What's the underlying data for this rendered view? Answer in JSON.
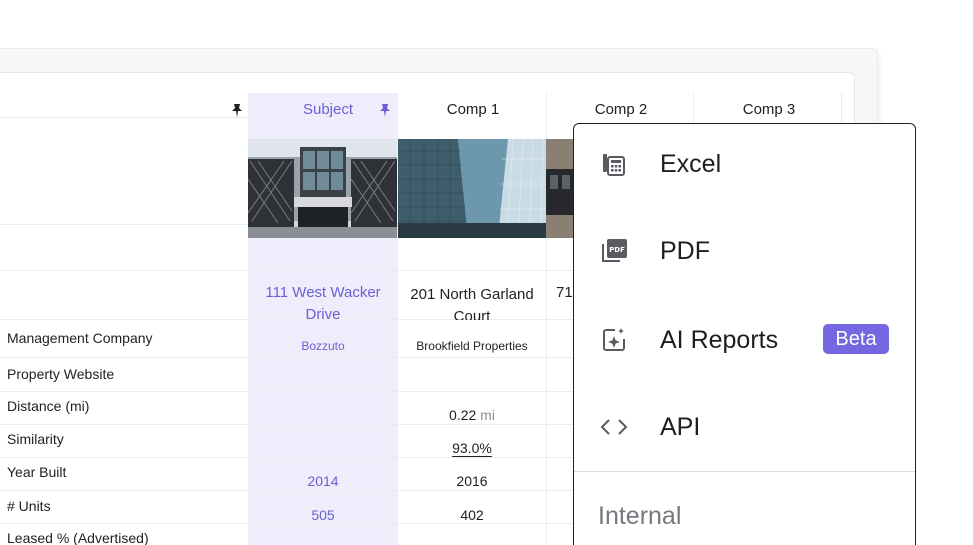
{
  "columns": {
    "subject": "Subject",
    "comp1": "Comp 1",
    "comp2": "Comp 2",
    "comp3": "Comp 3"
  },
  "addresses": {
    "subject_line1": "111 West Wacker",
    "subject_line2": "Drive",
    "comp1_line1": "201 North Garland",
    "comp1_line2": "Court",
    "comp2_partial": "71"
  },
  "rows": [
    {
      "label": "Management Company",
      "subject": "Bozzuto",
      "comp1": "Brookfield Properties"
    },
    {
      "label": "Property Website",
      "subject": "",
      "comp1": ""
    },
    {
      "label": "Distance (mi)",
      "subject": "",
      "comp1": "0.22",
      "comp1_unit": "mi"
    },
    {
      "label": "Similarity",
      "subject": "",
      "comp1": "93.0%"
    },
    {
      "label": "Year Built",
      "subject": "2014",
      "comp1": "2016"
    },
    {
      "label": "# Units",
      "subject": "505",
      "comp1": "402"
    },
    {
      "label": "Leased % (Advertised)",
      "subject": "",
      "comp1": ""
    }
  ],
  "export_menu": {
    "items": [
      {
        "label": "Excel",
        "icon": "calculator-icon"
      },
      {
        "label": "PDF",
        "icon": "pdf-icon"
      },
      {
        "label": "AI Reports",
        "icon": "ai-sparkle-icon",
        "badge": "Beta"
      },
      {
        "label": "API",
        "icon": "code-icon"
      }
    ],
    "section": "Internal"
  },
  "colors": {
    "accent": "#6a5fd6",
    "subject_bg": "#efedfb",
    "badge": "#7467e0"
  }
}
